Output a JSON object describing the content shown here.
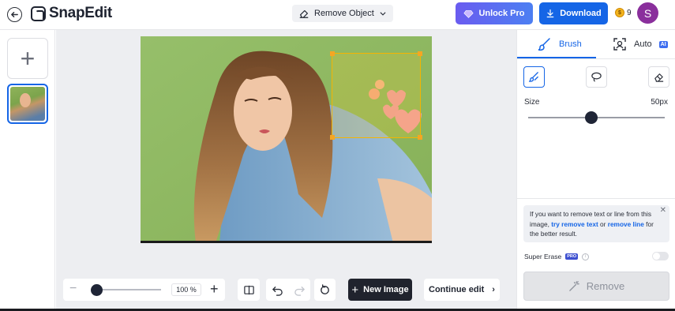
{
  "header": {
    "app_name": "SnapEdit",
    "tool_label": "Remove Object",
    "unlock_label": "Unlock Pro",
    "download_label": "Download",
    "coin_count": "9",
    "avatar_initial": "S"
  },
  "toolbar": {
    "zoom_value": "100 %",
    "new_image_label": "New Image",
    "continue_label": "Continue edit"
  },
  "panel": {
    "tabs": [
      {
        "label": "Brush",
        "active": true
      },
      {
        "label": "Auto",
        "badge": "AI",
        "active": false
      }
    ],
    "size_label": "Size",
    "size_value": "50px",
    "size_level": 0.46,
    "zoom_level": 0.05,
    "tip_prefix": "If you want to remove text or line from this image, ",
    "tip_link1": "try remove text",
    "tip_mid": " or ",
    "tip_link2": "remove line",
    "tip_suffix": " for the better result.",
    "super_erase_label": "Super Erase",
    "pro_badge": "PRO",
    "remove_label": "Remove"
  },
  "colors": {
    "accent": "#1565e6",
    "unlock_gradient_start": "#6a5cf0",
    "selection": "#f5b400",
    "avatar": "#8a2f9c"
  }
}
